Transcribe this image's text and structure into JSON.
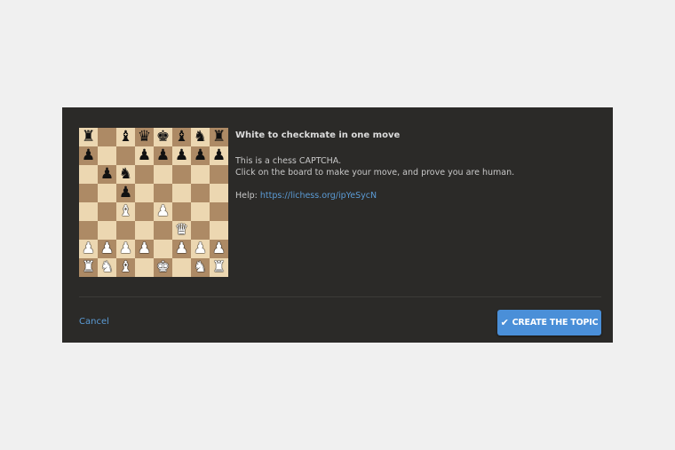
{
  "dialog": {
    "title": "White to checkmate in one move",
    "line1": "This is a chess CAPTCHA.",
    "line2": "Click on the board to make your move, and prove you are human.",
    "help_prefix": "Help: ",
    "help_link": "https://lichess.org/ipYeSycN"
  },
  "actions": {
    "cancel_label": "Cancel",
    "create_label": "CREATE THE TOPIC",
    "create_icon": "checkmark-icon"
  },
  "colors": {
    "panel": "#2b2a28",
    "light_square": "#ecd7b1",
    "dark_square": "#ad8a65",
    "accent": "#4a8fd8",
    "link": "#5b9bd5"
  },
  "board": {
    "rows": [
      [
        "bR",
        "",
        "bB",
        "bQ",
        "bK",
        "bB",
        "bN",
        "bR"
      ],
      [
        "bP",
        "",
        "",
        "bP",
        "bP",
        "bP",
        "bP",
        "bP"
      ],
      [
        "",
        "bP",
        "bN",
        "",
        "",
        "",
        "",
        ""
      ],
      [
        "",
        "",
        "bP",
        "",
        "",
        "",
        "",
        ""
      ],
      [
        "",
        "",
        "wB",
        "",
        "wP",
        "",
        "",
        ""
      ],
      [
        "",
        "",
        "",
        "",
        "",
        "wQ",
        "",
        ""
      ],
      [
        "wP",
        "wP",
        "wP",
        "wP",
        "",
        "wP",
        "wP",
        "wP"
      ],
      [
        "wR",
        "wN",
        "wB",
        "",
        "wK",
        "",
        "wN",
        "wR"
      ]
    ]
  }
}
